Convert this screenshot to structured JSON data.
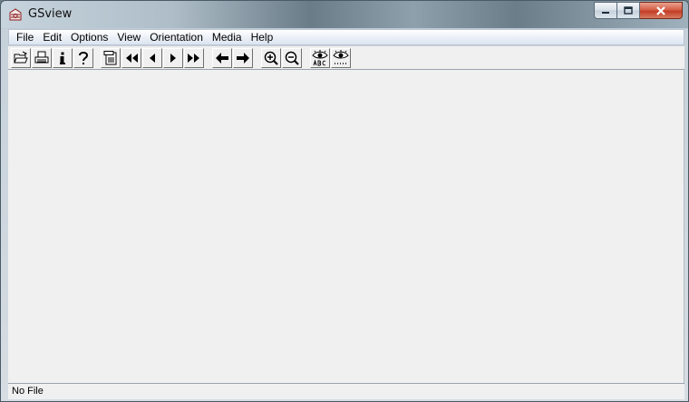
{
  "window": {
    "title": "GSview"
  },
  "menu": {
    "items": [
      "File",
      "Edit",
      "Options",
      "View",
      "Orientation",
      "Media",
      "Help"
    ]
  },
  "toolbar": {
    "buttons": [
      {
        "name": "open-icon"
      },
      {
        "name": "print-icon"
      },
      {
        "name": "info-icon"
      },
      {
        "name": "help-icon"
      },
      {
        "name": "goto-page-icon"
      },
      {
        "name": "first-page-icon"
      },
      {
        "name": "prev-page-icon"
      },
      {
        "name": "next-page-icon"
      },
      {
        "name": "last-page-icon"
      },
      {
        "name": "back-arrow-icon"
      },
      {
        "name": "forward-arrow-icon"
      },
      {
        "name": "zoom-in-icon"
      },
      {
        "name": "zoom-out-icon"
      },
      {
        "name": "text-extract-eye-icon"
      },
      {
        "name": "find-eye-icon"
      }
    ]
  },
  "status": {
    "text": "No File"
  }
}
